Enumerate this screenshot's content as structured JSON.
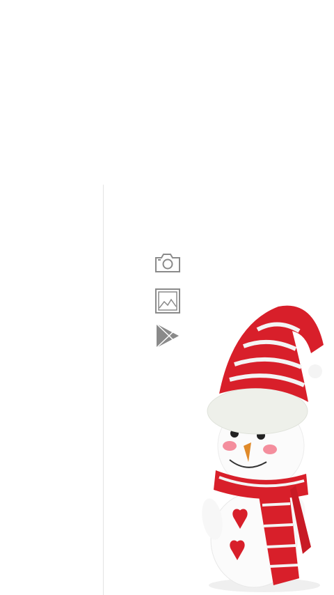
{
  "share_menu": {
    "options": [
      {
        "icon": "camera-icon"
      },
      {
        "icon": "image-gallery-icon"
      },
      {
        "icon": "play-store-icon"
      }
    ]
  },
  "wallpaper": {
    "subject": "snowman-illustration",
    "colors": {
      "hat_red": "#d81f2a",
      "stripe_white": "#f4f4f4",
      "body_white": "#fbfbfb",
      "cheek_pink": "#f27a8c",
      "nose_orange": "#e08a2a"
    }
  },
  "icon_color": "#8a8a8a"
}
